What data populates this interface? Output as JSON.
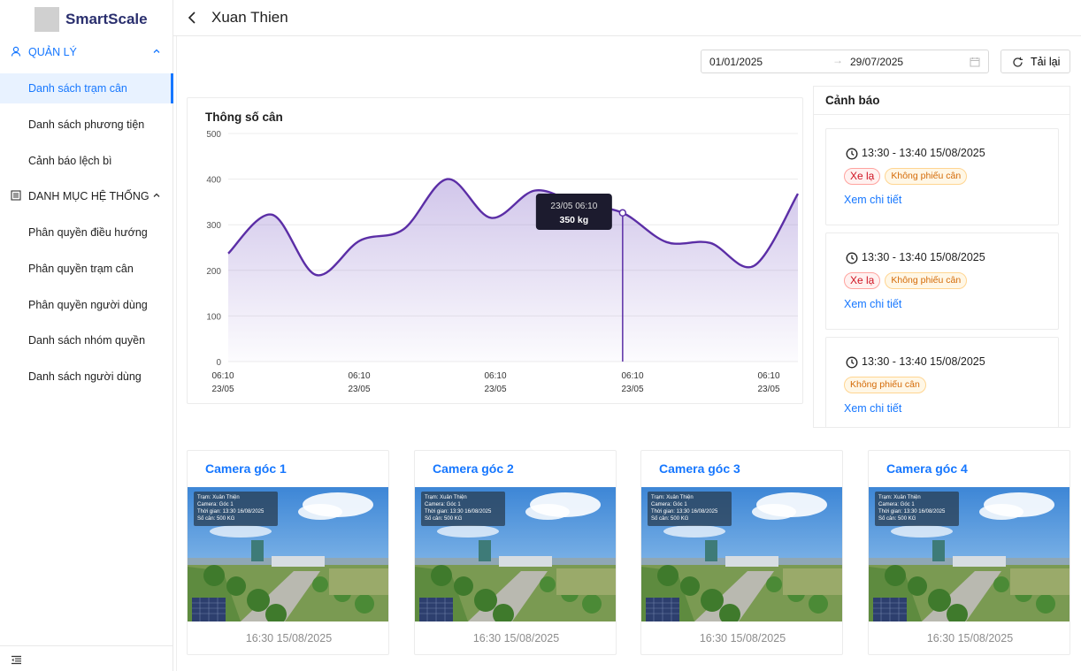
{
  "app": {
    "brand": "SmartScale"
  },
  "sidebar": {
    "groups": [
      {
        "label": "QUẢN LÝ",
        "expanded": true,
        "icon": "user-icon"
      },
      {
        "label": "DANH MỤC HỆ THỐNG",
        "expanded": true,
        "icon": "list-icon"
      }
    ],
    "items": [
      {
        "label": "Danh sách trạm cân",
        "active": true
      },
      {
        "label": "Danh sách phương tiện"
      },
      {
        "label": "Cảnh báo lệch bì"
      },
      {
        "label": "Phân quyền điều hướng"
      },
      {
        "label": "Phân quyền trạm cân"
      },
      {
        "label": "Phân quyền người dùng"
      },
      {
        "label": "Danh sách nhóm quyền"
      },
      {
        "label": "Danh sách người dùng"
      }
    ]
  },
  "header": {
    "title": "Xuan Thien"
  },
  "filters": {
    "date_from": "01/01/2025",
    "date_to": "29/07/2025",
    "arrow": "→",
    "reload_label": "Tải lại"
  },
  "chart": {
    "title": "Thông số cân",
    "tooltip_time": "23/05 06:10",
    "tooltip_value": "350 kg"
  },
  "chart_data": {
    "type": "area",
    "title": "Thông số cân",
    "ylim": [
      0,
      500
    ],
    "yticks": [
      0,
      100,
      200,
      300,
      400,
      500
    ],
    "xticks": [
      {
        "time": "06:10",
        "date": "23/05"
      },
      {
        "time": "06:10",
        "date": "23/05"
      },
      {
        "time": "06:10",
        "date": "23/05"
      },
      {
        "time": "06:10",
        "date": "23/05"
      },
      {
        "time": "06:10",
        "date": "23/05"
      }
    ],
    "points": [
      237,
      322,
      190,
      265,
      290,
      400,
      315,
      375,
      345,
      326,
      262,
      260,
      210,
      368
    ],
    "highlight_index": 9,
    "grid": true,
    "color": "#5b2ea6"
  },
  "warnings": {
    "title": "Cảnh báo",
    "items": [
      {
        "time": "13:30 - 13:40 15/08/2025",
        "tags": [
          {
            "label": "Xe lạ",
            "kind": "red"
          },
          {
            "label": "Không phiếu cân",
            "kind": "orange"
          }
        ],
        "link": "Xem chi tiết"
      },
      {
        "time": "13:30 - 13:40 15/08/2025",
        "tags": [
          {
            "label": "Xe lạ",
            "kind": "red"
          },
          {
            "label": "Không phiếu cân",
            "kind": "orange"
          }
        ],
        "link": "Xem chi tiết"
      },
      {
        "time": "13:30 - 13:40 15/08/2025",
        "tags": [
          {
            "label": "Không phiếu cân",
            "kind": "orange"
          }
        ],
        "link": "Xem chi tiết"
      }
    ]
  },
  "cameras": [
    {
      "title": "Camera góc 1",
      "time": "16:30 15/08/2025",
      "overlay": [
        "Trạm: Xuân Thiện",
        "Camera: Góc 1",
        "Thời gian: 13:30 16/08/2025",
        "Số cân: 500 KG"
      ]
    },
    {
      "title": "Camera góc 2",
      "time": "16:30 15/08/2025",
      "overlay": [
        "Trạm: Xuân Thiện",
        "Camera: Góc 1",
        "Thời gian: 13:30 16/08/2025",
        "Số cân: 500 KG"
      ]
    },
    {
      "title": "Camera góc 3",
      "time": "16:30 15/08/2025",
      "overlay": [
        "Trạm: Xuân Thiện",
        "Camera: Góc 1",
        "Thời gian: 13:30 16/08/2025",
        "Số cân: 500 KG"
      ]
    },
    {
      "title": "Camera góc 4",
      "time": "16:30 15/08/2025",
      "overlay": [
        "Trạm: Xuân Thiện",
        "Camera: Góc 1",
        "Thời gian: 13:30 16/08/2025",
        "Số cân: 500 KG"
      ]
    }
  ]
}
